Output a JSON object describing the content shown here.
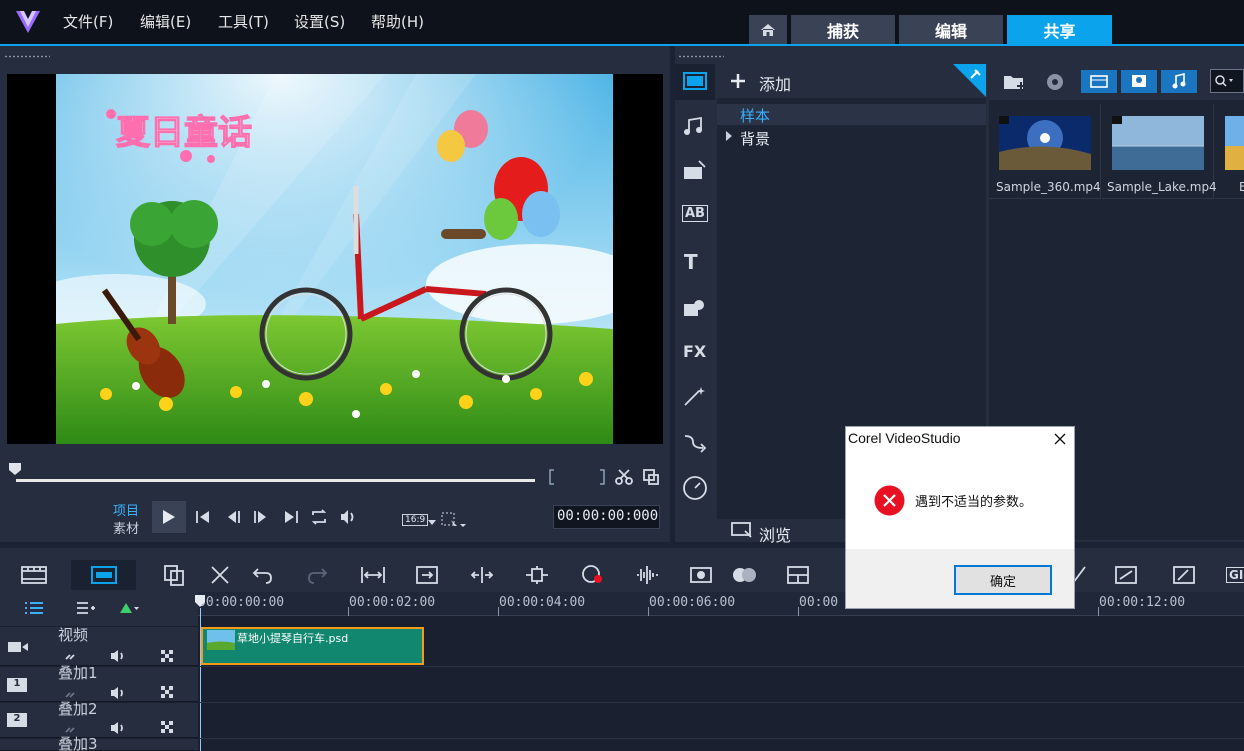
{
  "menu": {
    "file": "文件(F)",
    "edit": "编辑(E)",
    "tools": "工具(T)",
    "settings": "设置(S)",
    "help": "帮助(H)"
  },
  "tabs": {
    "capture": "捕获",
    "edit": "编辑",
    "share": "共享",
    "active": "share"
  },
  "preview": {
    "project_label": "项目",
    "clip_label": "素材",
    "aspect_ratio": "16:9",
    "timecode": "00:00:00:000",
    "scene_title": "夏日童话"
  },
  "library": {
    "add_label": "添加",
    "tree_items": [
      {
        "label": "样本",
        "selected": true
      },
      {
        "label": "背景",
        "expandable": true
      }
    ],
    "browse_label": "浏览",
    "thumbnails": [
      {
        "name": "Sample_360.mp4"
      },
      {
        "name": "Sample_Lake.mp4"
      },
      {
        "name": "B"
      }
    ]
  },
  "timeline": {
    "ruler": [
      "00:00:00:00",
      "00:00:02:00",
      "00:00:04:00",
      "00:00:06:00",
      "00:00",
      "00:00:12:00"
    ],
    "tracks": [
      {
        "name": "视频",
        "badge": ""
      },
      {
        "name": "叠加1",
        "badge": "1"
      },
      {
        "name": "叠加2",
        "badge": "2"
      },
      {
        "name": "叠加3",
        "badge": ""
      }
    ],
    "clip_name": "草地小提琴自行车.psd",
    "gif_label": "GIF"
  },
  "dialog": {
    "title": "Corel VideoStudio",
    "message": "遇到不适当的参数。",
    "ok_label": "确定"
  },
  "colors": {
    "accent": "#0aa3ec",
    "clip": "#12876f",
    "clip_border": "#f59a1b",
    "error": "#e81123"
  }
}
